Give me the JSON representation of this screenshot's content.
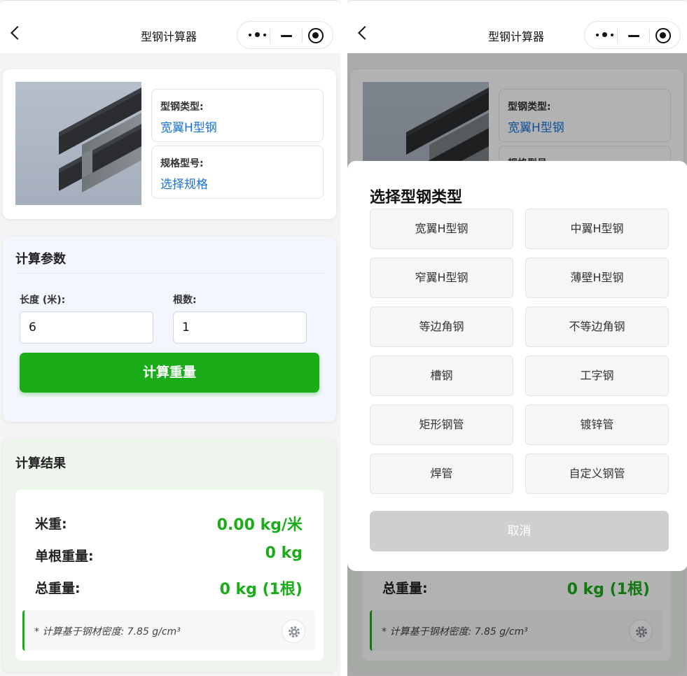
{
  "nav": {
    "title": "型钢计算器"
  },
  "info": {
    "type_label": "型钢类型:",
    "type_value": "宽翼H型钢",
    "spec_label": "规格型号:",
    "spec_value": "选择规格"
  },
  "params": {
    "title": "计算参数",
    "length_label": "长度 (米):",
    "length_value": "6",
    "count_label": "根数:",
    "count_value": "1",
    "calc_button": "计算重量"
  },
  "result": {
    "title": "计算结果",
    "meter_weight_label": "米重:",
    "meter_weight_value": "0.00 kg/米",
    "single_weight_label": "单根重量:",
    "single_weight_value": "0 kg",
    "total_weight_label": "总重量:",
    "total_weight_value": "0 kg (1根)",
    "note": "* 计算基于钢材密度: 7.85 g/cm³"
  },
  "modal": {
    "title": "选择型钢类型",
    "options": [
      "宽翼H型钢",
      "中翼H型钢",
      "窄翼H型钢",
      "薄壁H型钢",
      "等边角钢",
      "不等边角钢",
      "槽钢",
      "工字钢",
      "矩形钢管",
      "镀锌管",
      "焊管",
      "自定义钢管"
    ],
    "cancel": "取消"
  },
  "colors": {
    "accent_green": "#1aad19",
    "link_blue": "#1a73d9"
  },
  "icons": {
    "back": "chevron-left-icon",
    "more": "more-dots-icon",
    "minimize": "minus-icon",
    "close": "target-circle-icon",
    "settings": "gear-icon"
  }
}
